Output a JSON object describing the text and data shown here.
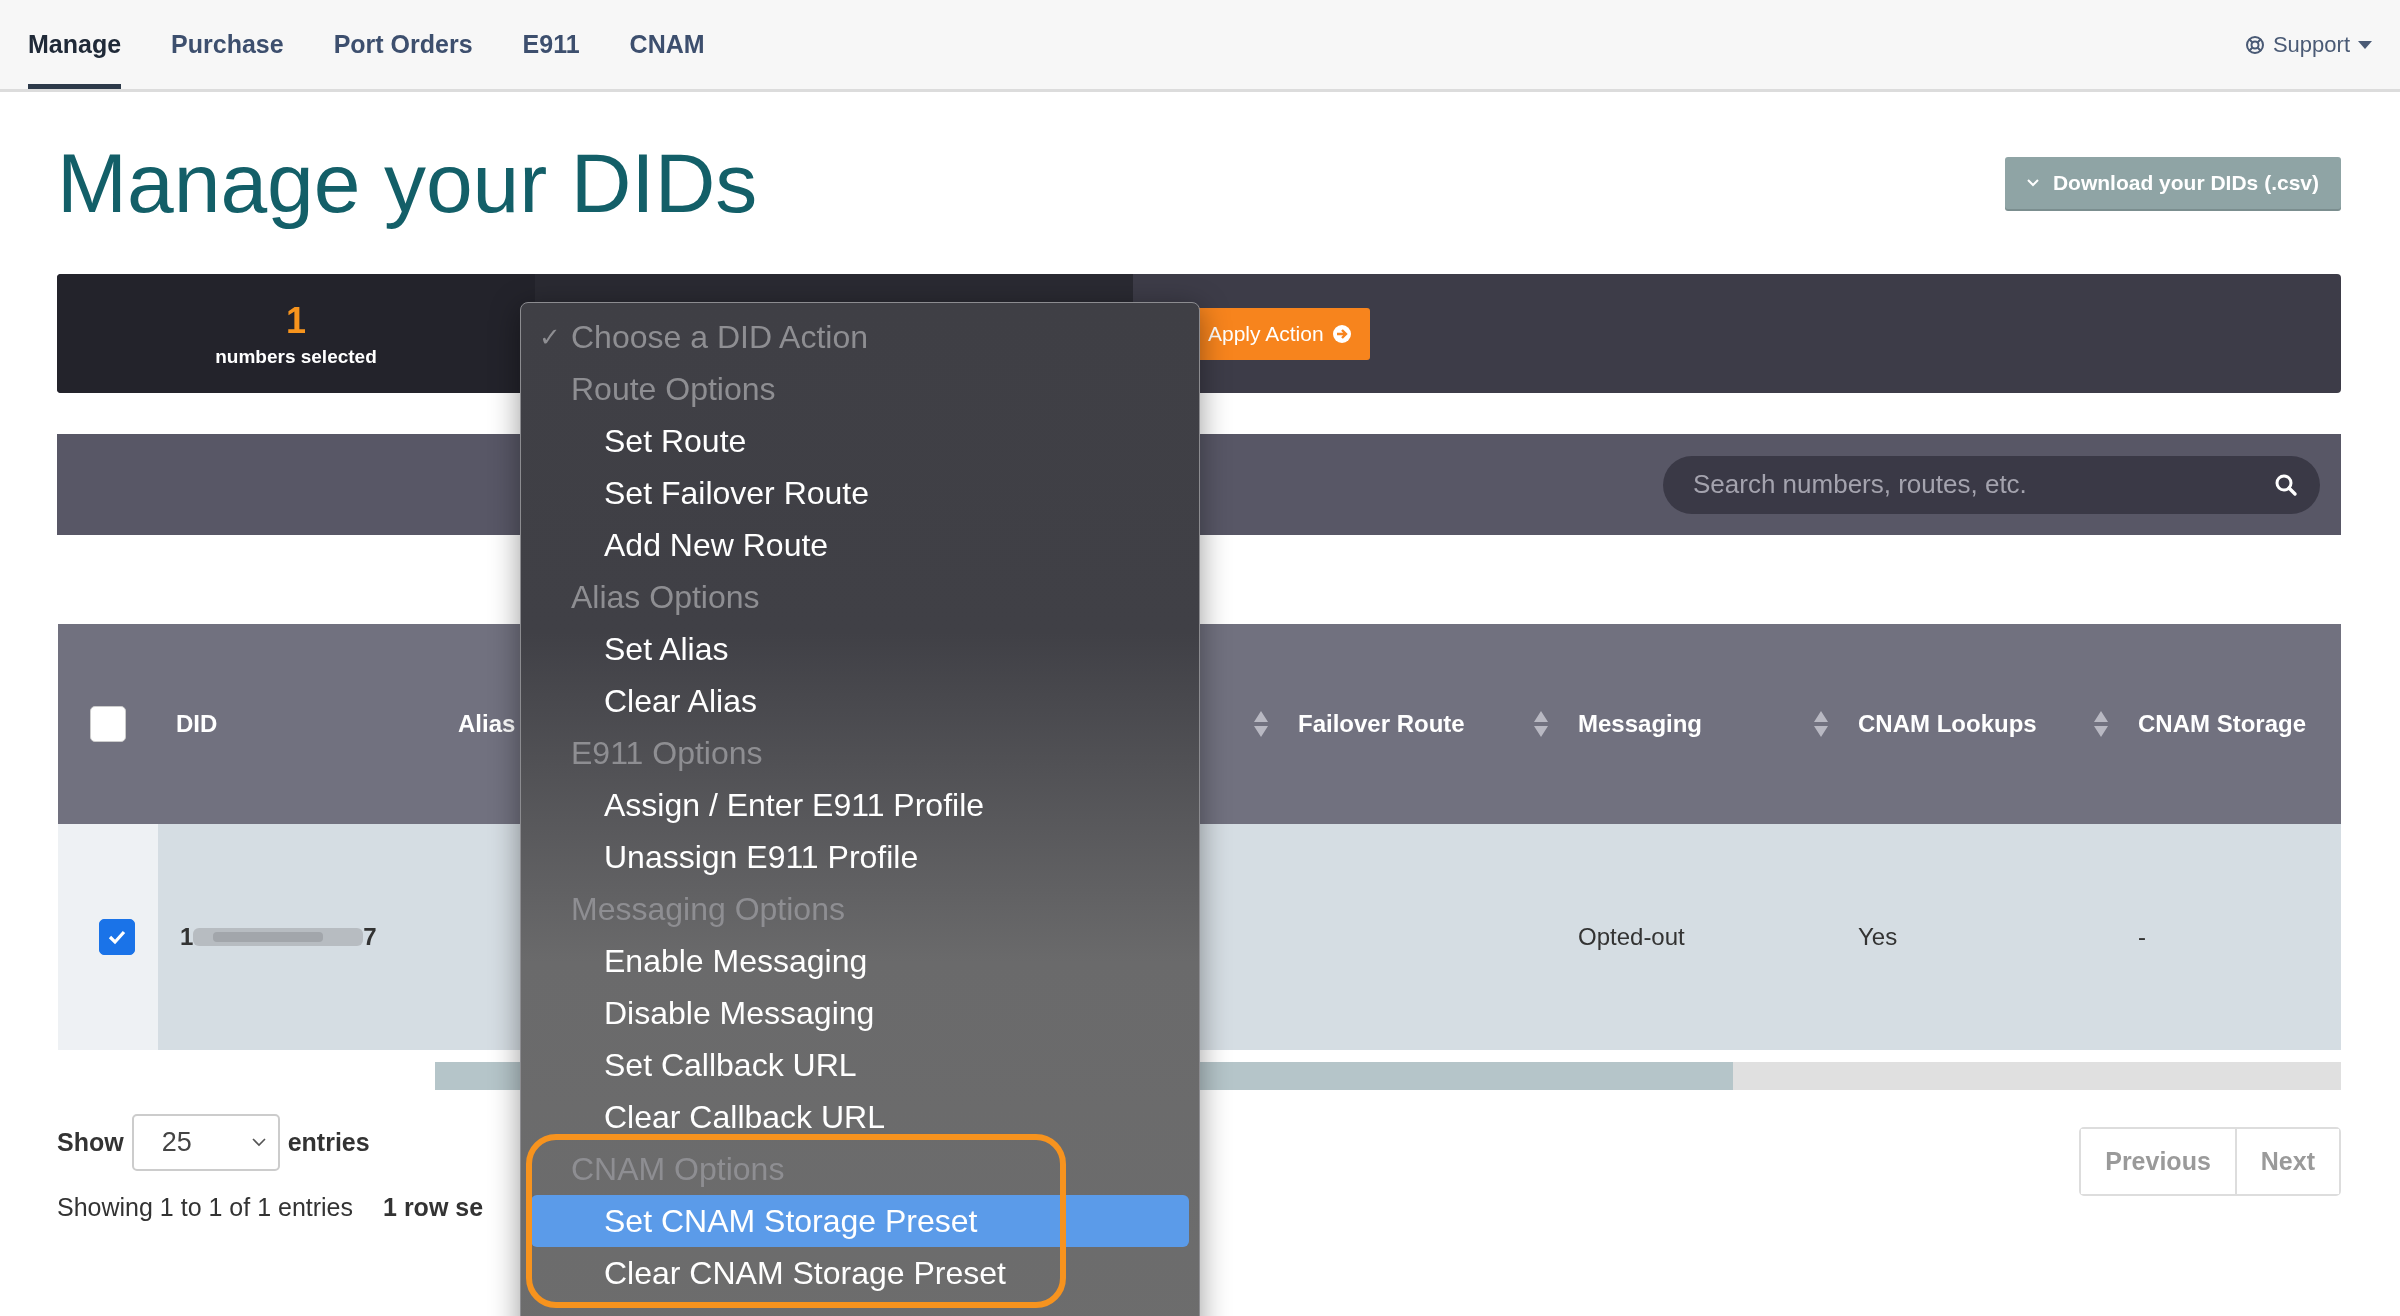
{
  "nav": {
    "tabs": [
      {
        "label": "Manage",
        "selected": true
      },
      {
        "label": "Purchase",
        "selected": false
      },
      {
        "label": "Port Orders",
        "selected": false
      },
      {
        "label": "E911",
        "selected": false
      },
      {
        "label": "CNAM",
        "selected": false
      }
    ],
    "support": "Support"
  },
  "title": "Manage your DIDs",
  "download_button": "Download your DIDs (.csv)",
  "action_bar": {
    "count": "1",
    "count_label": "numbers selected",
    "apply_button": "Apply Action"
  },
  "search": {
    "placeholder": "Search numbers, routes, etc."
  },
  "table": {
    "select_all_checked": false,
    "columns": [
      {
        "label": "DID",
        "sortable": false
      },
      {
        "label": "Alias",
        "sortable": false
      },
      {
        "sortable": true
      },
      {
        "label": "Failover Route",
        "sortable": true
      },
      {
        "label": "Messaging",
        "sortable": true
      },
      {
        "label": "CNAM Lookups",
        "sortable": true
      },
      {
        "label": "CNAM Storage",
        "sortable": false
      }
    ],
    "rows": [
      {
        "checked": true,
        "did_start": "1",
        "did_end": "7",
        "messaging": "Opted-out",
        "cnam_lookups": "Yes",
        "cnam_storage": "-"
      }
    ]
  },
  "length": {
    "label_before": "Show",
    "value": "25",
    "label_after": "entries"
  },
  "info": {
    "text": "Showing 1 to 1 of 1 entries",
    "selection": "1 row se"
  },
  "pagination": [
    "Previous",
    "Next"
  ],
  "action_menu": {
    "current": {
      "check": "✓",
      "label": "Choose a DID Action"
    },
    "groups": [
      {
        "label": "Route Options",
        "outlined": false,
        "options": [
          {
            "label": "Set Route",
            "selected": false
          },
          {
            "label": "Set Failover Route",
            "selected": false
          },
          {
            "label": "Add New Route",
            "selected": false
          }
        ]
      },
      {
        "label": "Alias Options",
        "outlined": false,
        "options": [
          {
            "label": "Set Alias",
            "selected": false
          },
          {
            "label": "Clear Alias",
            "selected": false
          }
        ]
      },
      {
        "label": "E911 Options",
        "outlined": false,
        "options": [
          {
            "label": "Assign / Enter E911 Profile",
            "selected": false
          },
          {
            "label": "Unassign E911 Profile",
            "selected": false
          }
        ]
      },
      {
        "label": "Messaging Options",
        "outlined": false,
        "options": [
          {
            "label": "Enable Messaging",
            "selected": false
          },
          {
            "label": "Disable Messaging",
            "selected": false
          },
          {
            "label": "Set Callback URL",
            "selected": false
          },
          {
            "label": "Clear Callback URL",
            "selected": false
          }
        ]
      },
      {
        "label": "CNAM Options",
        "outlined": true,
        "options": [
          {
            "label": "Set CNAM Storage Preset",
            "selected": true
          },
          {
            "label": "Clear CNAM Storage Preset",
            "selected": false
          }
        ]
      }
    ]
  }
}
